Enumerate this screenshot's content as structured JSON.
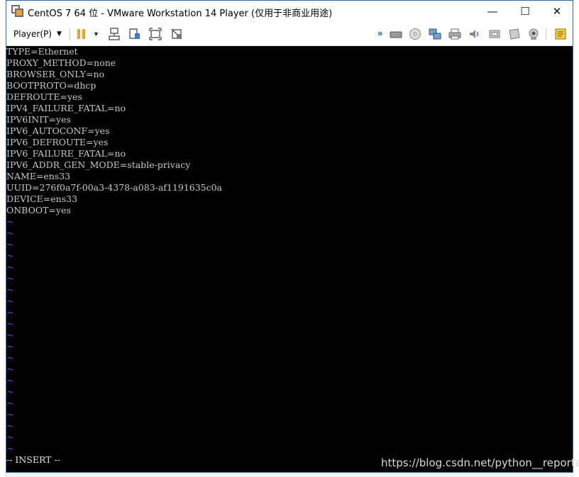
{
  "window": {
    "title": "CentOS 7 64 位 - VMware Workstation 14 Player (仅用于非商业用途)",
    "controls": [
      "—",
      "☐",
      "✕"
    ]
  },
  "toolbar": {
    "player_menu_label": "Player(P)",
    "left_icons": [
      "pause-icon",
      "send-ctrl-alt-del-icon",
      "unity-icon",
      "full-screen-icon",
      "exit-full-screen-icon"
    ],
    "right_icons": [
      "more-devices-icon",
      "hard-disk-icon",
      "cd-dvd-icon",
      "network-adapter-icon",
      "printer-icon",
      "sound-card-icon",
      "usb-icon",
      "floppy-icon",
      "webcam-icon",
      "message-log-icon"
    ],
    "accent_pause": "#f0a030"
  },
  "terminal": {
    "lines": [
      "TYPE=Ethernet",
      "PROXY_METHOD=none",
      "BROWSER_ONLY=no",
      "BOOTPROTO=dhcp",
      "DEFROUTE=yes",
      "IPV4_FAILURE_FATAL=no",
      "IPV6INIT=yes",
      "IPV6_AUTOCONF=yes",
      "IPV6_DEFROUTE=yes",
      "IPV6_FAILURE_FATAL=no",
      "IPV6_ADDR_GEN_MODE=stable-privacy",
      "NAME=ens33",
      "UUID=276f0a7f-00a3-4378-a083-af1191635c0a",
      "DEVICE=ens33",
      "ONBOOT=yes"
    ],
    "tilde": "~",
    "tilde_count": 21,
    "mode_line": "-- INSERT --",
    "tilde_color": "#4f5fff"
  },
  "watermark": "https://blog.csdn.net/python__reported"
}
